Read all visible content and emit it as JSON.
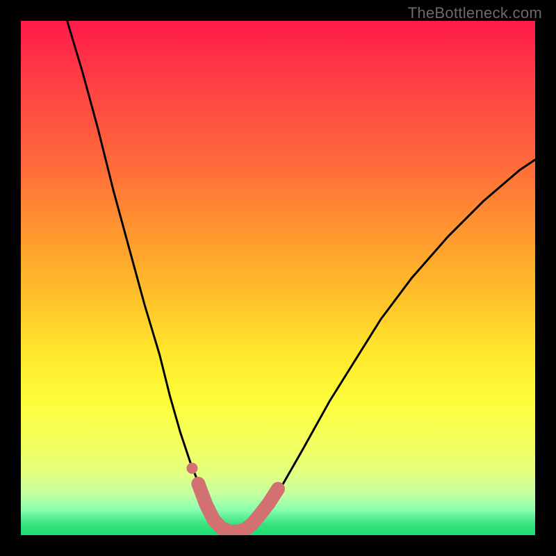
{
  "watermark": "TheBottleneck.com",
  "colors": {
    "frame": "#000000",
    "gradient_top": "#ff1a4a",
    "gradient_mid": "#ffe92c",
    "gradient_bottom": "#1adf70",
    "curve": "#000000",
    "marker": "#d37172"
  },
  "chart_data": {
    "type": "line",
    "title": "",
    "xlabel": "",
    "ylabel": "",
    "xlim": [
      0,
      100
    ],
    "ylim": [
      0,
      100
    ],
    "series": [
      {
        "name": "bottleneck-curve",
        "x": [
          9,
          12,
          15,
          18,
          21,
          24,
          27,
          29,
          31,
          33,
          35,
          36.5,
          38,
          39.2,
          40,
          41,
          42,
          43.5,
          45.5,
          48,
          51,
          55,
          60,
          65,
          70,
          76,
          83,
          90,
          97,
          100
        ],
        "values": [
          100,
          90,
          79,
          67,
          56,
          45,
          35,
          27,
          20,
          14,
          9,
          5.5,
          3,
          1.4,
          0.7,
          0.5,
          0.6,
          1.2,
          2.8,
          5.5,
          10,
          17,
          26,
          34,
          42,
          50,
          58,
          65,
          71,
          73
        ]
      }
    ],
    "markers": {
      "name": "highlight-region",
      "points": [
        {
          "x": 34.5,
          "y": 10
        },
        {
          "x": 36.0,
          "y": 6
        },
        {
          "x": 37.5,
          "y": 3
        },
        {
          "x": 39.0,
          "y": 1.4
        },
        {
          "x": 40.5,
          "y": 0.7
        },
        {
          "x": 42.0,
          "y": 0.7
        },
        {
          "x": 43.5,
          "y": 1.0
        },
        {
          "x": 45.0,
          "y": 2.2
        },
        {
          "x": 46.5,
          "y": 4.0
        },
        {
          "x": 48.2,
          "y": 6.2
        },
        {
          "x": 50.0,
          "y": 9.0
        }
      ],
      "isolated_point": {
        "x": 33.3,
        "y": 13
      }
    }
  }
}
